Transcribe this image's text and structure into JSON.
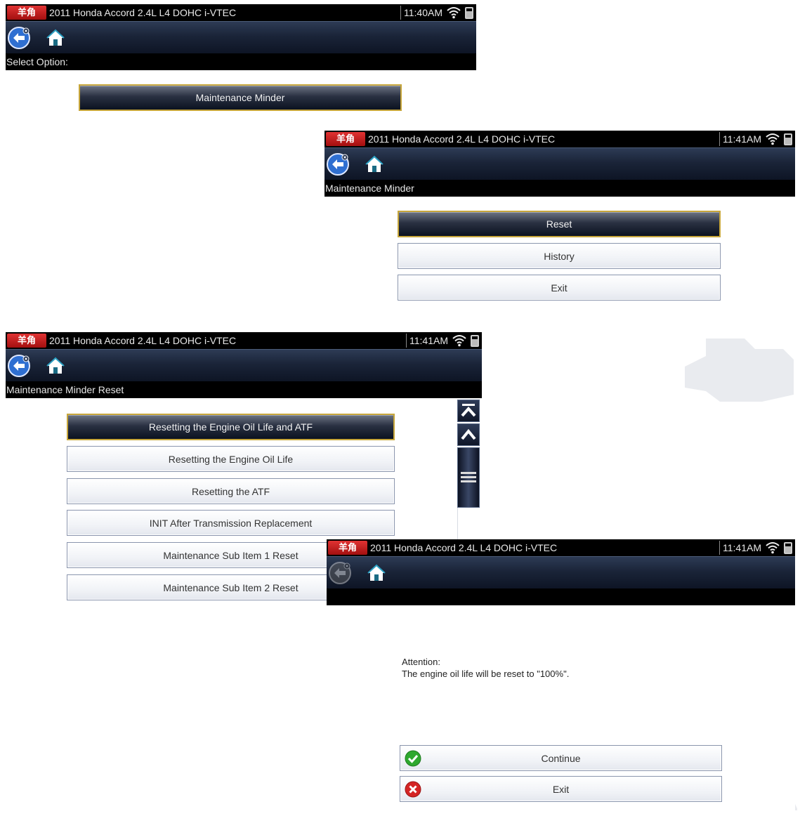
{
  "vehicle": "2011 Honda Accord 2.4L L4 DOHC i-VTEC",
  "logo_text": "羊角",
  "screens": {
    "s1": {
      "time": "11:40AM",
      "breadcrumb": "Select Option:",
      "buttons": [
        {
          "label": "Maintenance Minder",
          "selected": true
        }
      ]
    },
    "s2": {
      "time": "11:41AM",
      "breadcrumb": "Maintenance Minder",
      "buttons": [
        {
          "label": "Reset",
          "selected": true
        },
        {
          "label": "History",
          "selected": false
        },
        {
          "label": "Exit",
          "selected": false
        }
      ]
    },
    "s3": {
      "time": "11:41AM",
      "breadcrumb": "Maintenance Minder Reset",
      "buttons": [
        {
          "label": "Resetting the Engine Oil Life and ATF",
          "selected": true
        },
        {
          "label": "Resetting the Engine Oil Life",
          "selected": false
        },
        {
          "label": "Resetting the ATF",
          "selected": false
        },
        {
          "label": "INIT After Transmission Replacement",
          "selected": false
        },
        {
          "label": "Maintenance Sub Item 1 Reset",
          "selected": false
        },
        {
          "label": "Maintenance Sub Item 2 Reset",
          "selected": false
        }
      ]
    },
    "s4": {
      "time": "11:41AM",
      "breadcrumb": "",
      "message_title": "Attention:",
      "message_body": "The engine oil life will be reset to \"100%\".",
      "buttons": [
        {
          "label": "Continue",
          "icon": "check-icon"
        },
        {
          "label": "Exit",
          "icon": "x-icon"
        }
      ]
    }
  },
  "icons": {
    "back": "back-arrow-icon",
    "home": "home-icon",
    "wifi": "wifi-icon",
    "battery": "battery-icon",
    "scroll_top": "scroll-top-icon",
    "scroll_up": "scroll-up-icon",
    "scroll_grip": "scroll-grip-icon"
  },
  "colors": {
    "accent_selected_border": "#c7a63a",
    "titlebar": "#000000",
    "logo_red": "#d32222",
    "continue_green": "#2ea82e",
    "exit_red": "#d42424"
  }
}
